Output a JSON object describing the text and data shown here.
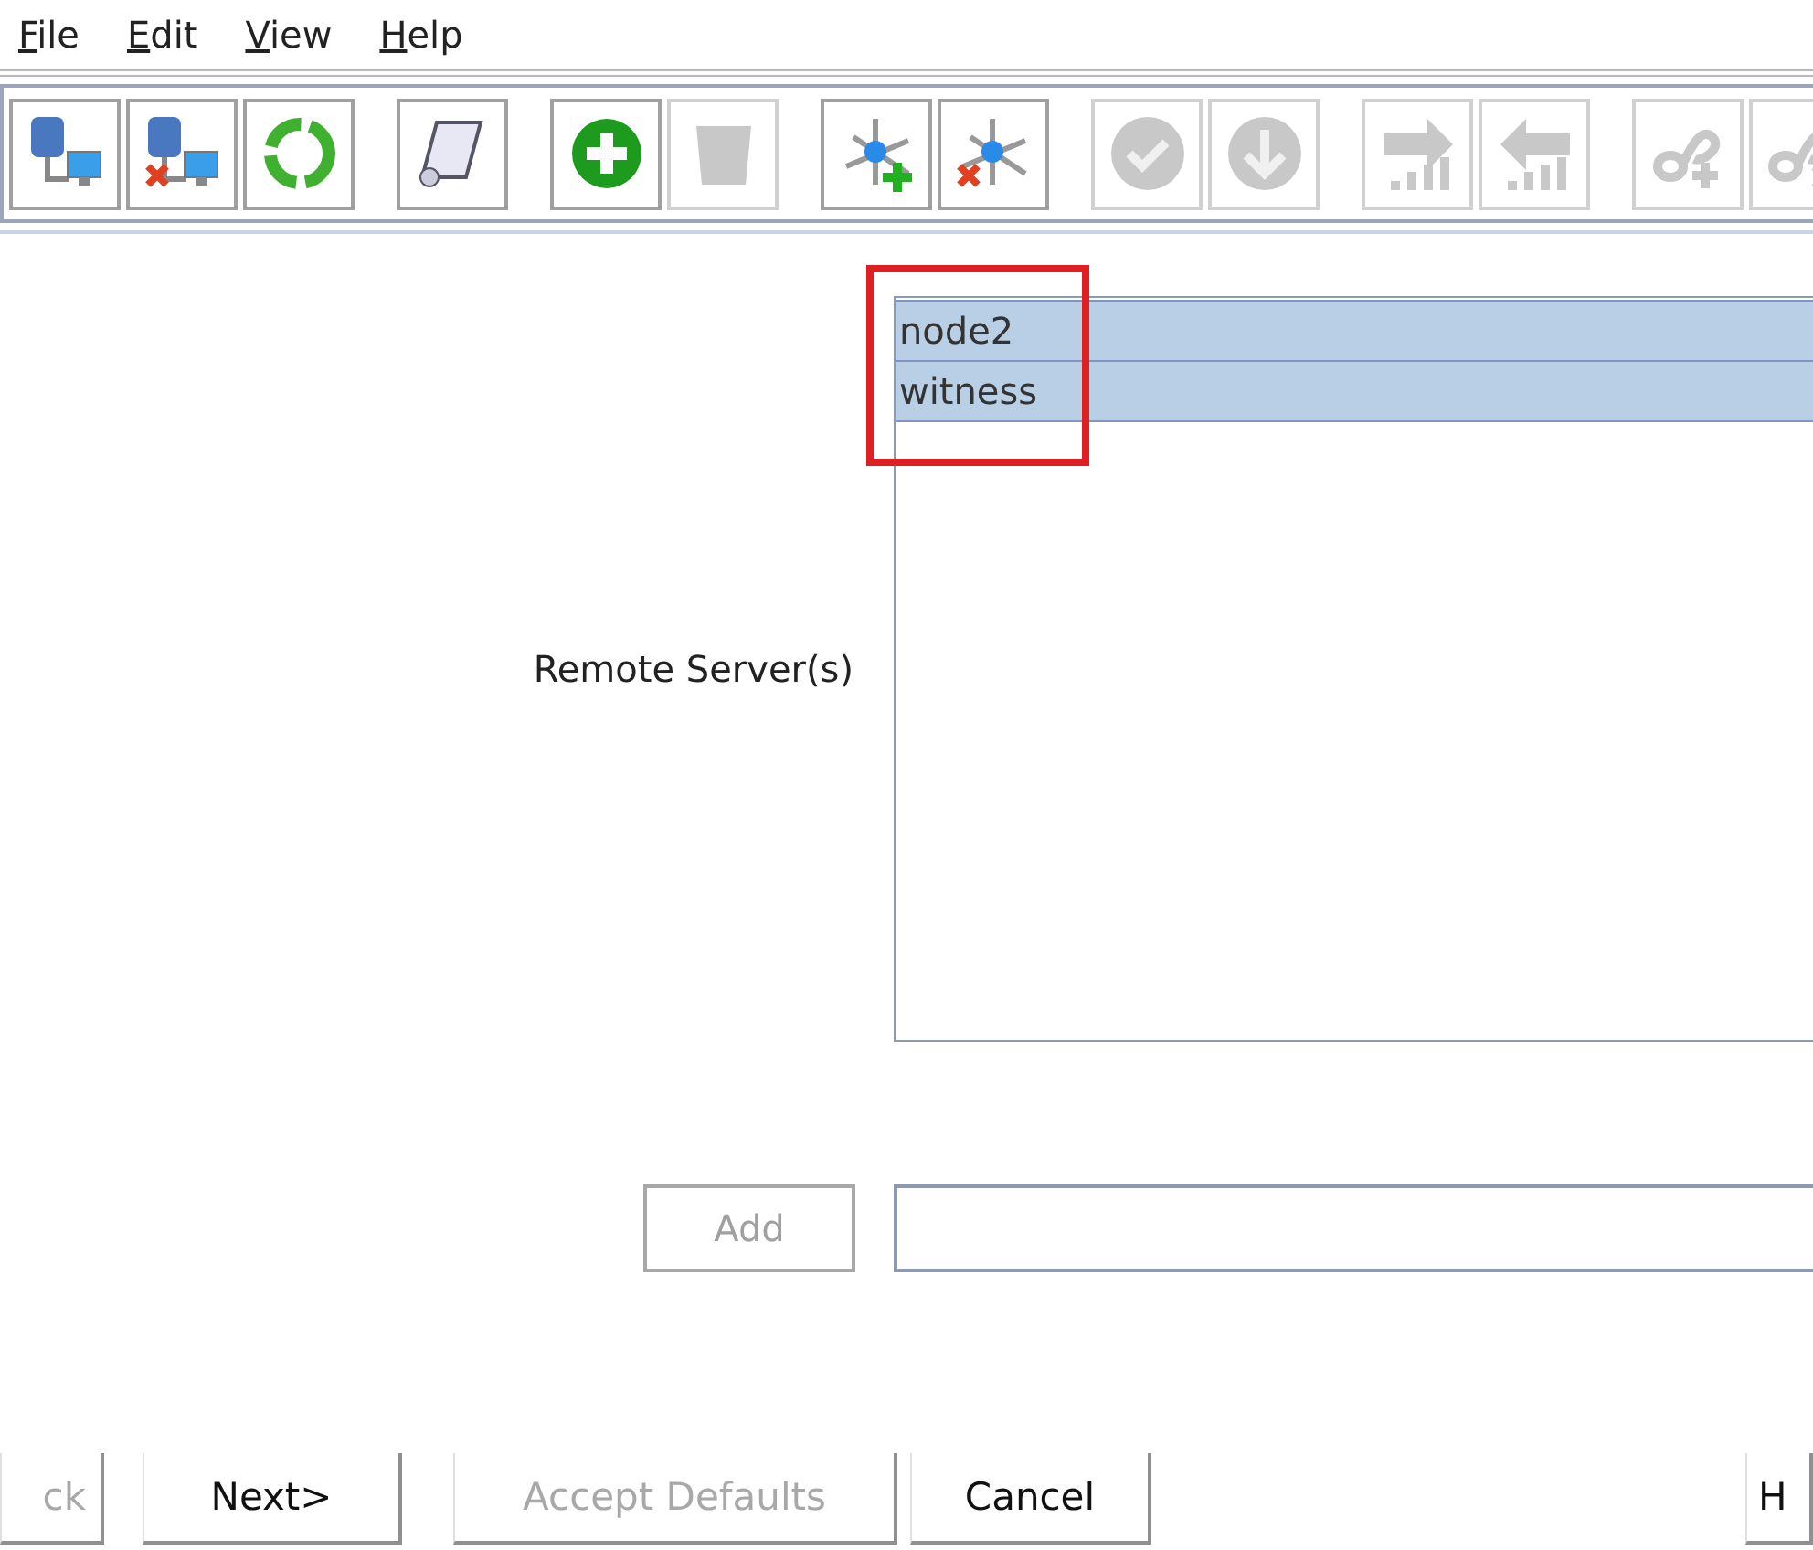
{
  "menu": [
    {
      "label": "File"
    },
    {
      "label": "Edit"
    },
    {
      "label": "View"
    },
    {
      "label": "Help"
    }
  ],
  "toolbar": [
    [
      {
        "kind": "server-link",
        "disabled": false
      },
      {
        "kind": "server-unlink",
        "disabled": false
      },
      {
        "kind": "refresh",
        "disabled": false
      }
    ],
    [
      {
        "kind": "scroll",
        "disabled": false
      }
    ],
    [
      {
        "kind": "add",
        "disabled": false
      },
      {
        "kind": "trash",
        "disabled": true
      }
    ],
    [
      {
        "kind": "node-add",
        "disabled": false
      },
      {
        "kind": "node-remove",
        "disabled": false
      }
    ],
    [
      {
        "kind": "check",
        "disabled": true
      },
      {
        "kind": "down",
        "disabled": true
      }
    ],
    [
      {
        "kind": "send",
        "disabled": true
      },
      {
        "kind": "receive",
        "disabled": true
      }
    ],
    [
      {
        "kind": "link-add",
        "disabled": true
      },
      {
        "kind": "link-remove",
        "disabled": true
      }
    ]
  ],
  "form": {
    "label": "Remote Server(s)",
    "servers": [
      {
        "name": "node2",
        "selected": true
      },
      {
        "name": "witness",
        "selected": true
      }
    ],
    "add_button": {
      "label": "Add",
      "disabled": true
    }
  },
  "buttons": [
    {
      "label": "ck",
      "disabled": true
    },
    {
      "label": "Next>",
      "disabled": false
    },
    {
      "label": "Accept Defaults",
      "disabled": true
    },
    {
      "label": "Cancel",
      "disabled": false
    },
    {
      "label": "H",
      "disabled": false
    }
  ]
}
